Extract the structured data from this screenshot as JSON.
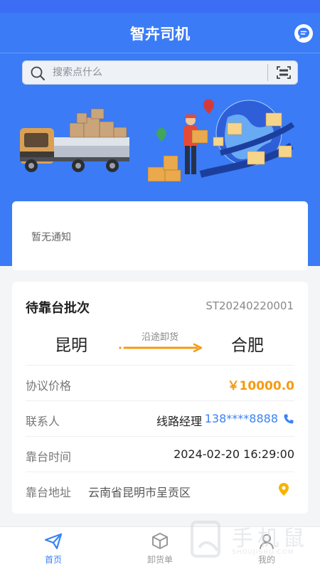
{
  "app": {
    "title": "智卉司机"
  },
  "search": {
    "placeholder": "搜索点什么"
  },
  "notice": {
    "text": "暂无通知"
  },
  "order": {
    "title": "待靠台批次",
    "order_no": "ST20240220001",
    "from_city": "昆明",
    "to_city": "合肥",
    "route_note": "沿途卸货",
    "price_label": "协议价格",
    "price_value": "￥10000.0",
    "contact_label": "联系人",
    "contact_name": "线路经理",
    "contact_phone": "138****8888",
    "dock_time_label": "靠台时间",
    "dock_time_value": "2024-02-20 16:29:00",
    "dock_address_label": "靠台地址",
    "dock_address_value": "云南省昆明市呈贡区"
  },
  "tabbar": {
    "items": [
      {
        "label": "首页",
        "icon": "paper-plane-icon",
        "active": true
      },
      {
        "label": "卸货单",
        "icon": "box-icon",
        "active": false
      },
      {
        "label": "我的",
        "icon": "user-icon",
        "active": false
      }
    ]
  },
  "watermark": {
    "text": "手机鼠",
    "sub": "SHOUJISHU.COM"
  },
  "colors": {
    "primary": "#3b7bf6",
    "accent": "#f59a12",
    "link": "#3b82f6"
  }
}
